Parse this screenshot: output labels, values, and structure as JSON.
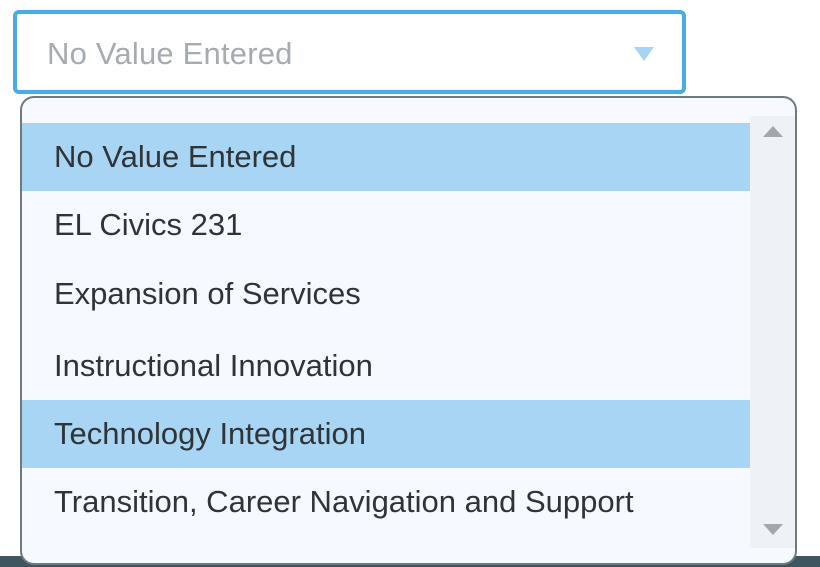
{
  "select": {
    "value": "No Value Entered",
    "arrow_icon": "chevron-down-icon"
  },
  "dropdown": {
    "options": [
      {
        "label": "No Value Entered",
        "highlighted": true
      },
      {
        "label": "EL Civics 231",
        "highlighted": false
      },
      {
        "label": "Expansion of Services",
        "highlighted": false
      },
      {
        "label": "Instructional Innovation",
        "highlighted": false
      },
      {
        "label": "Technology Integration",
        "highlighted": true
      },
      {
        "label": "Transition, Career Navigation and Support",
        "highlighted": false
      }
    ],
    "scrollbar": {
      "up_icon": "scroll-up-icon",
      "down_icon": "scroll-down-icon"
    }
  },
  "colors": {
    "focus_border": "#47ace0",
    "highlight": "#a9d5f4",
    "placeholder_text": "#a6aab1",
    "option_text": "#2f3437"
  }
}
